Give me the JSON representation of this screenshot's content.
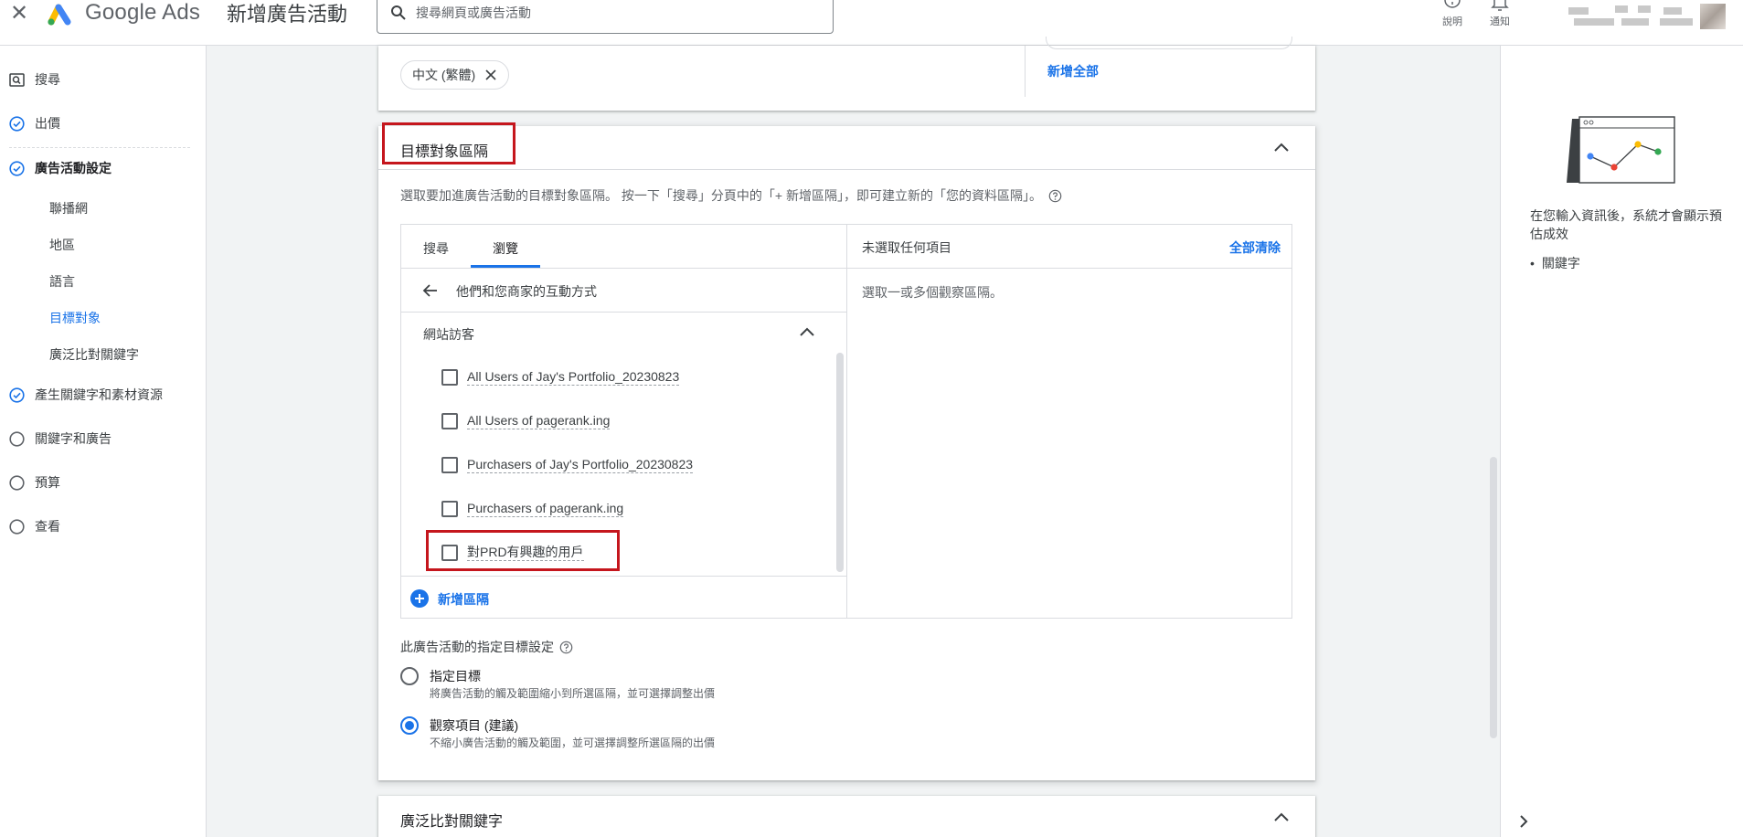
{
  "header": {
    "brand": "Google Ads",
    "page_title": "新增廣告活動",
    "search_placeholder": "搜尋網頁或廣告活動",
    "help_label": "說明",
    "notifications_label": "通知"
  },
  "sidebar": {
    "items": [
      {
        "label": "搜尋",
        "state": "search"
      },
      {
        "label": "出價",
        "state": "done"
      },
      {
        "label": "廣告活動設定",
        "state": "done"
      },
      {
        "label": "產生關鍵字和素材資源",
        "state": "done"
      },
      {
        "label": "關鍵字和廣告",
        "state": "todo"
      },
      {
        "label": "預算",
        "state": "todo"
      },
      {
        "label": "查看",
        "state": "todo"
      }
    ],
    "sub_items": [
      {
        "label": "聯播網",
        "active": false
      },
      {
        "label": "地區",
        "active": false
      },
      {
        "label": "語言",
        "active": false
      },
      {
        "label": "目標對象",
        "active": true
      },
      {
        "label": "廣泛比對關鍵字",
        "active": false
      }
    ]
  },
  "language_card": {
    "chip_label": "中文 (繁體)",
    "add_all_label": "新增全部"
  },
  "audience_card": {
    "title": "目標對象區隔",
    "description": "選取要加進廣告活動的目標對象區隔。 按一下「搜尋」分頁中的「+ 新增區隔」，即可建立新的「您的資料區隔」。",
    "tabs": [
      {
        "label": "搜尋",
        "active": false
      },
      {
        "label": "瀏覽",
        "active": true
      }
    ],
    "back_label": "他們和您商家的互動方式",
    "group_label": "網站訪客",
    "options": [
      {
        "label": "All Users of Jay's Portfolio_20230823",
        "checked": false
      },
      {
        "label": "All Users of pagerank.ing",
        "checked": false
      },
      {
        "label": "Purchasers of Jay's Portfolio_20230823",
        "checked": false
      },
      {
        "label": "Purchasers of pagerank.ing",
        "checked": false
      },
      {
        "label": "對PRD有興趣的用戶",
        "checked": false
      }
    ],
    "add_segment_label": "新增區隔",
    "selected_header": "未選取任何項目",
    "clear_all_label": "全部清除",
    "empty_message": "選取一或多個觀察區隔。",
    "setting_label": "此廣告活動的指定目標設定",
    "radio_options": [
      {
        "title": "指定目標",
        "desc": "將廣告活動的觸及範圍縮小到所選區隔，並可選擇調整出價",
        "selected": false
      },
      {
        "title": "觀察項目 (建議)",
        "desc": "不縮小廣告活動的觸及範圍，並可選擇調整所選區隔的出價",
        "selected": true
      }
    ]
  },
  "next_card": {
    "title": "廣泛比對關鍵字"
  },
  "right_panel": {
    "text": "在您輸入資訊後，系統才會顯示預估成效",
    "bullet": "關鍵字"
  },
  "colors": {
    "accent": "#1a73e8",
    "highlight": "#c5161d"
  }
}
